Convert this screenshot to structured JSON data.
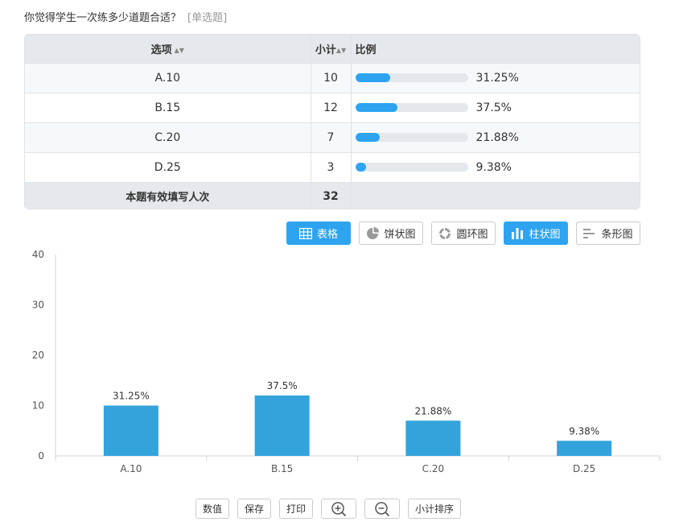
{
  "question": {
    "title": "你觉得学生一次练多少道题合适？",
    "type": "[单选题]"
  },
  "table": {
    "headers": {
      "option": "选项",
      "count": "小计",
      "ratio": "比例"
    },
    "rows": [
      {
        "option": "A.10",
        "count": "10",
        "percent": "31.25%",
        "fraction": 0.3125
      },
      {
        "option": "B.15",
        "count": "12",
        "percent": "37.5%",
        "fraction": 0.375
      },
      {
        "option": "C.20",
        "count": "7",
        "percent": "21.88%",
        "fraction": 0.2188
      },
      {
        "option": "D.25",
        "count": "3",
        "percent": "9.38%",
        "fraction": 0.0938
      }
    ],
    "total_label": "本题有效填写人次",
    "total_value": "32"
  },
  "view_buttons": {
    "table": "表格",
    "pie": "饼状图",
    "ring": "圆环图",
    "column": "柱状图",
    "bar": "条形图"
  },
  "tools": {
    "values": "数值",
    "save": "保存",
    "print": "打印",
    "sort": "小计排序"
  },
  "colors": {
    "accent": "#2ea4f0",
    "bar": "#33a3dc"
  },
  "chart_data": {
    "type": "bar",
    "categories": [
      "A.10",
      "B.15",
      "C.20",
      "D.25"
    ],
    "values": [
      10,
      12,
      7,
      3
    ],
    "labels": [
      "31.25%",
      "37.5%",
      "21.88%",
      "9.38%"
    ],
    "ylim": [
      0,
      40
    ],
    "yticks": [
      0,
      10,
      20,
      30,
      40
    ],
    "grid": false
  }
}
